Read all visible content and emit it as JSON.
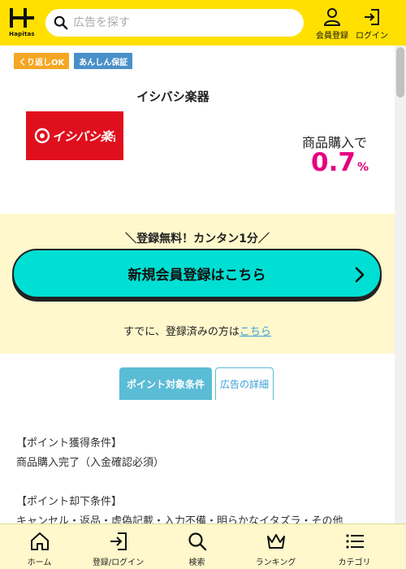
{
  "header": {
    "logo_text": "Hapitas",
    "search_placeholder": "広告を探す",
    "register_label": "会員登録",
    "login_label": "ログイン"
  },
  "badges": [
    "くり返しOK",
    "あんしん保証"
  ],
  "store": {
    "name": "イシバシ楽器",
    "logo_text": "イシバシ楽器",
    "purchase_label": "商品購入で",
    "rate_value": "0.7",
    "rate_unit": "%"
  },
  "register": {
    "subtitle": "登録無料！カンタン1分",
    "button_label": "新規会員登録はこちら",
    "already_text": "すでに、登録済みの方は",
    "already_link": "こちら"
  },
  "tabs": [
    {
      "label": "ポイント対象条件",
      "active": true
    },
    {
      "label": "広告の詳細",
      "active": false
    }
  ],
  "conditions": {
    "acquire_title": "【ポイント獲得条件】",
    "acquire_text": "商品購入完了（入金確認必須）",
    "reject_title": "【ポイント却下条件】",
    "reject_text": "キャンセル・返品・虚偽記載・入力不備・明らかなイタズラ・その他"
  },
  "bottom_nav": [
    {
      "label": "ホーム",
      "icon": "home-icon"
    },
    {
      "label": "登録/ログイン",
      "icon": "login-icon"
    },
    {
      "label": "検索",
      "icon": "search-icon"
    },
    {
      "label": "ランキング",
      "icon": "crown-icon"
    },
    {
      "label": "カテゴリ",
      "icon": "list-icon"
    }
  ],
  "colors": {
    "brand_yellow": "#ffe000",
    "accent_cyan": "#00dfd4",
    "rate_pink": "#e4007f",
    "tab_blue": "#5bbcd6",
    "store_red": "#e00f1d"
  }
}
